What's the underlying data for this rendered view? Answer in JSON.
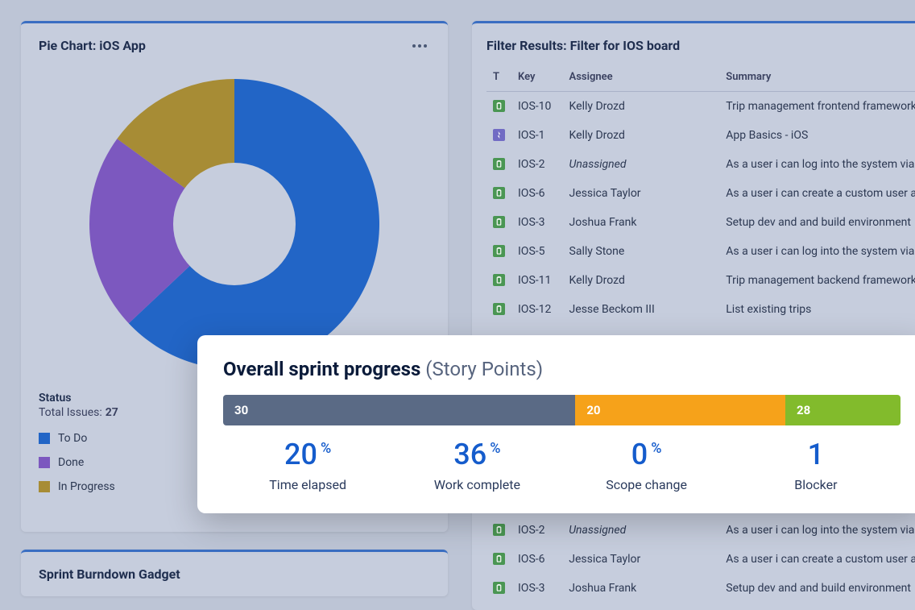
{
  "pie_card": {
    "title": "Pie Chart: iOS App",
    "status_label": "Status",
    "total_label": "Total Issues:",
    "total_count": "27",
    "legend": [
      {
        "label": "To Do",
        "color": "#2265c6"
      },
      {
        "label": "Done",
        "color": "#7c58bf"
      },
      {
        "label": "In Progress",
        "color": "#a78c35"
      }
    ]
  },
  "chart_data": {
    "type": "pie",
    "title": "Pie Chart: iOS App",
    "total": 27,
    "series": [
      {
        "name": "To Do",
        "value": 17,
        "fraction": 0.63,
        "color": "#2265c6"
      },
      {
        "name": "Done",
        "value": 6,
        "fraction": 0.22,
        "color": "#7c58bf"
      },
      {
        "name": "In Progress",
        "value": 4,
        "fraction": 0.15,
        "color": "#a78c35"
      }
    ]
  },
  "burndown": {
    "title": "Sprint Burndown Gadget"
  },
  "filter_card": {
    "title": "Filter Results: Filter for IOS board",
    "columns": {
      "t": "T",
      "key": "Key",
      "assignee": "Assignee",
      "summary": "Summary"
    },
    "rows": [
      {
        "type": "story",
        "key": "IOS-10",
        "assignee": "Kelly Drozd",
        "summary": "Trip management frontend framework"
      },
      {
        "type": "epic",
        "key": "IOS-1",
        "assignee": "Kelly Drozd",
        "summary": "App Basics - iOS"
      },
      {
        "type": "story",
        "key": "IOS-2",
        "assignee": "Unassigned",
        "assignee_italic": true,
        "summary": "As a user i can log into the system via"
      },
      {
        "type": "story",
        "key": "IOS-6",
        "assignee": "Jessica Taylor",
        "summary": "As a user i can create a custom user a"
      },
      {
        "type": "story",
        "key": "IOS-3",
        "assignee": "Joshua Frank",
        "summary": "Setup dev and and build environment"
      },
      {
        "type": "story",
        "key": "IOS-5",
        "assignee": "Sally Stone",
        "summary": "As a user i can log into the system via"
      },
      {
        "type": "story",
        "key": "IOS-11",
        "assignee": "Kelly Drozd",
        "summary": "Trip management backend framework"
      },
      {
        "type": "story",
        "key": "IOS-12",
        "assignee": "Jesse Beckom III",
        "summary": "List existing trips"
      }
    ],
    "rows_lower": [
      {
        "type": "story",
        "key": "IOS-2",
        "assignee": "Unassigned",
        "assignee_italic": true,
        "summary": "As a user i can log into the system via"
      },
      {
        "type": "story",
        "key": "IOS-6",
        "assignee": "Jessica Taylor",
        "summary": "As a user i can create a custom user a"
      },
      {
        "type": "story",
        "key": "IOS-3",
        "assignee": "Joshua Frank",
        "summary": "Setup dev and and build environment"
      }
    ]
  },
  "sprint": {
    "title": "Overall sprint progress",
    "subtitle": "(Story Points)",
    "segments": [
      {
        "label": "30",
        "width": 52
      },
      {
        "label": "20",
        "width": 31
      },
      {
        "label": "28",
        "width": 17
      }
    ],
    "metrics": [
      {
        "value": "20",
        "suffix": "%",
        "label": "Time elapsed"
      },
      {
        "value": "36",
        "suffix": "%",
        "label": "Work complete"
      },
      {
        "value": "0",
        "suffix": "%",
        "label": "Scope change"
      },
      {
        "value": "1",
        "suffix": "",
        "label": "Blocker"
      }
    ]
  }
}
